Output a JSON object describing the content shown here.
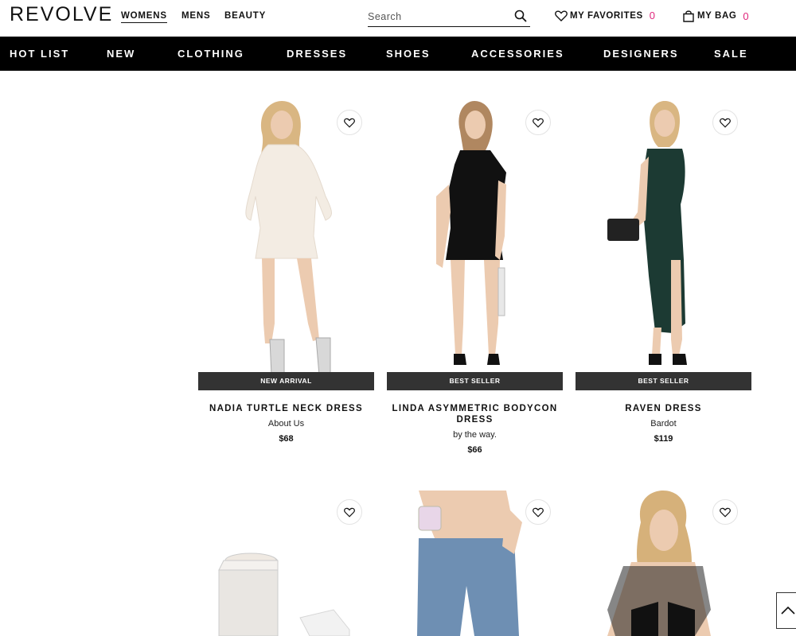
{
  "header": {
    "logo": "REVOLVE",
    "genders": [
      "WOMENS",
      "MENS",
      "BEAUTY"
    ],
    "search_placeholder": "Search",
    "favorites_label": "MY FAVORITES",
    "favorites_count": "0",
    "bag_label": "MY BAG",
    "bag_count": "0"
  },
  "nav": [
    "HOT LIST",
    "NEW",
    "CLOTHING",
    "DRESSES",
    "SHOES",
    "ACCESSORIES",
    "DESIGNERS",
    "SALE"
  ],
  "products": [
    {
      "name": "NADIA TURTLE NECK DRESS",
      "brand": "About Us",
      "price": "$68",
      "badge": "NEW ARRIVAL"
    },
    {
      "name": "LINDA ASYMMETRIC BODYCON DRESS",
      "brand": "by the way.",
      "price": "$66",
      "badge": "BEST SELLER"
    },
    {
      "name": "RAVEN DRESS",
      "brand": "Bardot",
      "price": "$119",
      "badge": "BEST SELLER"
    }
  ],
  "colors": {
    "accent": "#e0287d",
    "nav_bg": "#000000",
    "badge_bg": "#333333"
  }
}
